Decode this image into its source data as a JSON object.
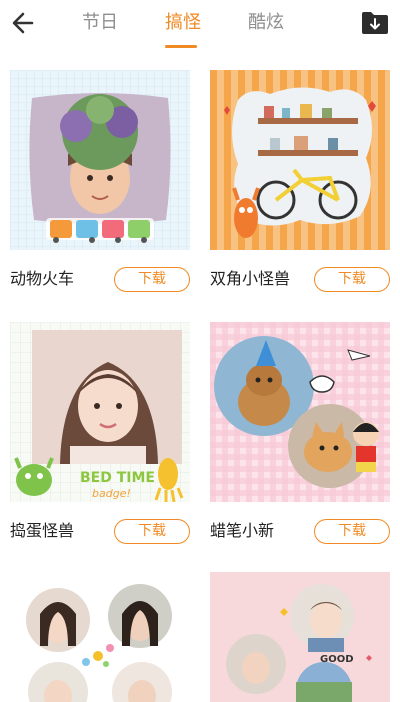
{
  "header": {
    "tabs": [
      {
        "label": "节日"
      },
      {
        "label": "搞怪"
      },
      {
        "label": "酷炫"
      }
    ],
    "active_tab": "搞怪",
    "accent_color": "#f08a24"
  },
  "download_label": "下载",
  "templates": [
    {
      "name": "动物火车"
    },
    {
      "name": "双角小怪兽"
    },
    {
      "name": "捣蛋怪兽"
    },
    {
      "name": "蜡笔小新"
    }
  ],
  "thumb_texts": {
    "bedtime_line1": "BED TIME",
    "bedtime_line2": "badge!",
    "good_sticker": "GOOD"
  }
}
